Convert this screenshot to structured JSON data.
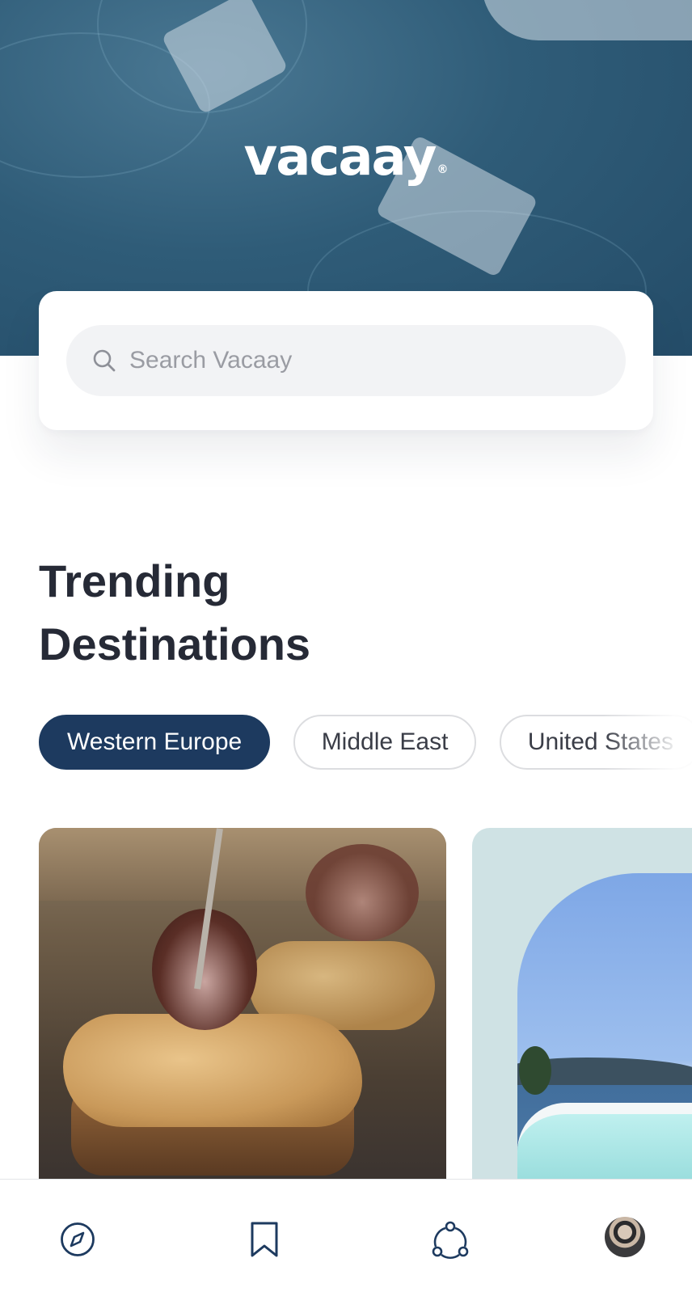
{
  "brand": {
    "logo_text": "vacaay",
    "logo_mark": "®"
  },
  "search": {
    "placeholder": "Search Vacaay",
    "value": ""
  },
  "section": {
    "title_line1": "Trending",
    "title_line2": "Destinations"
  },
  "filters": {
    "chips": [
      {
        "label": "Western Europe",
        "active": true
      },
      {
        "label": "Middle East",
        "active": false
      },
      {
        "label": "United States",
        "active": false
      }
    ]
  },
  "cards": [
    {
      "image": "grilled-squid-pintxos"
    },
    {
      "image": "santorini-arch-pool-view"
    }
  ],
  "bottom_nav": {
    "items": [
      {
        "icon": "compass-icon"
      },
      {
        "icon": "bookmark-icon"
      },
      {
        "icon": "community-icon"
      },
      {
        "icon": "profile-avatar"
      }
    ]
  },
  "colors": {
    "primary": "#1d3a5f",
    "text": "#262a36",
    "placeholder": "#9a9ca3",
    "search_bg": "#f2f3f5",
    "chip_border": "#dcdde0"
  }
}
